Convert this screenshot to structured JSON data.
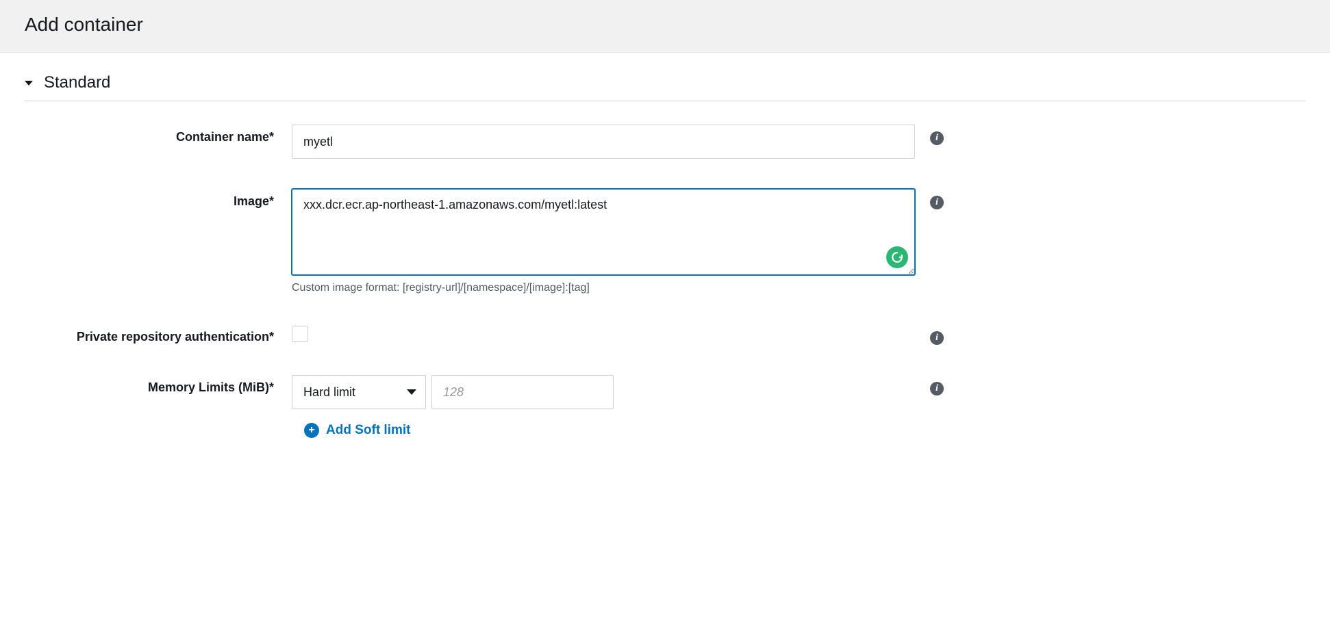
{
  "header": {
    "title": "Add container"
  },
  "section": {
    "title": "Standard"
  },
  "form": {
    "containerName": {
      "label": "Container name*",
      "value": "myetl"
    },
    "image": {
      "label": "Image*",
      "value": "xxx.dcr.ecr.ap-northeast-1.amazonaws.com/myetl:latest",
      "help": "Custom image format: [registry-url]/[namespace]/[image]:[tag]"
    },
    "privateRepoAuth": {
      "label": "Private repository authentication*"
    },
    "memory": {
      "label": "Memory Limits (MiB)*",
      "limitType": "Hard limit",
      "placeholder": "128",
      "addSoftLabel": "Add Soft limit"
    }
  },
  "icons": {
    "info": "i",
    "plus": "+",
    "grammarly": "G"
  }
}
